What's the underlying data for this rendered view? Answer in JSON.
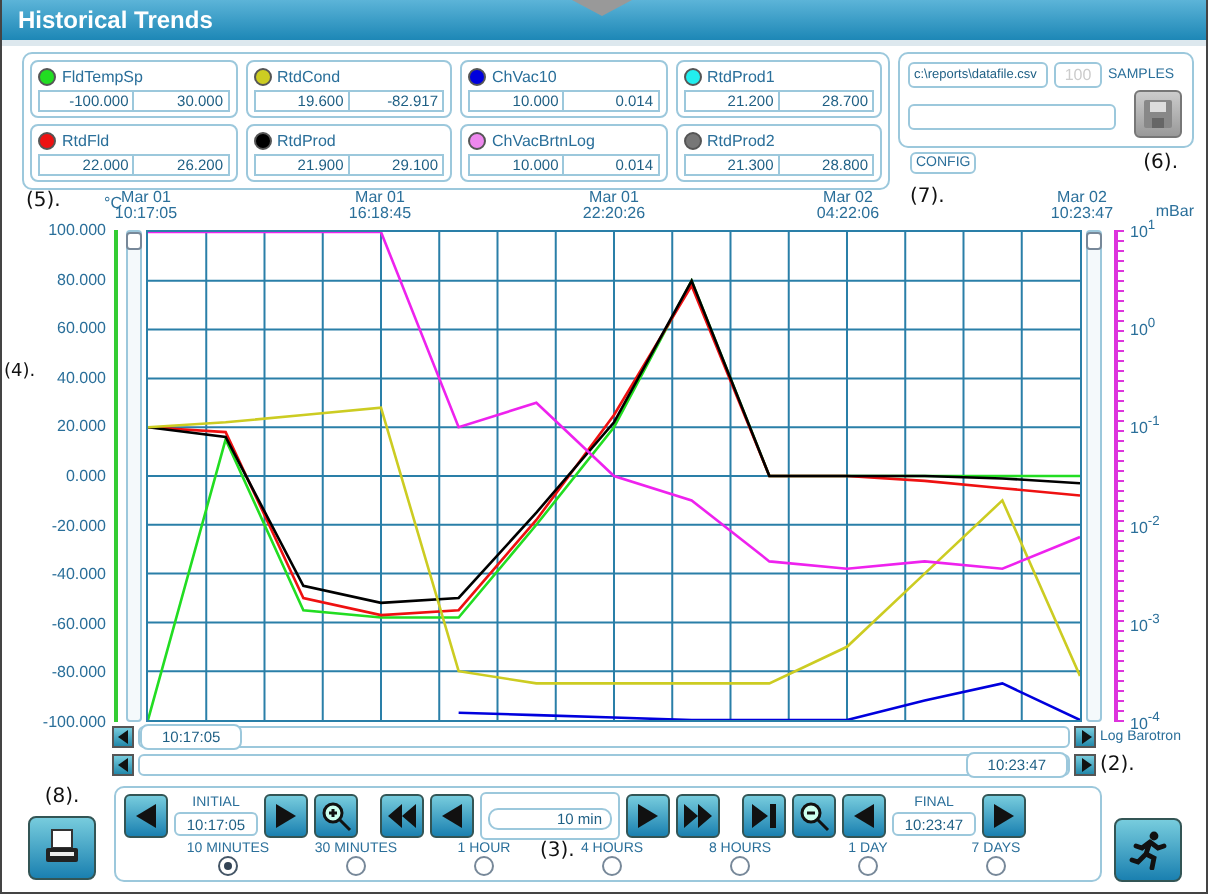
{
  "window": {
    "title": "Historical Trends"
  },
  "tags": [
    {
      "name": "FldTempSp",
      "color": "#22dd22",
      "min": "-100.000",
      "max": "30.000"
    },
    {
      "name": "RtdCond",
      "color": "#cccc22",
      "min": "19.600",
      "max": "-82.917"
    },
    {
      "name": "ChVac10",
      "color": "#0000dd",
      "min": "10.000",
      "max": "0.014"
    },
    {
      "name": "RtdProd1",
      "color": "#22eeee",
      "min": "21.200",
      "max": "28.700"
    },
    {
      "name": "RtdFld",
      "color": "#ee1111",
      "min": "22.000",
      "max": "26.200"
    },
    {
      "name": "RtdProd",
      "color": "#000000",
      "min": "21.900",
      "max": "29.100"
    },
    {
      "name": "ChVacBrtnLog",
      "color": "#ee88ee",
      "min": "10.000",
      "max": "0.014"
    },
    {
      "name": "RtdProd2",
      "color": "#777777",
      "min": "21.300",
      "max": "28.800"
    }
  ],
  "export": {
    "file": "c:\\reports\\datafile.csv",
    "samples": "100",
    "samples_disabled": true,
    "samples_label": "SAMPLES",
    "save_disabled": true
  },
  "config_button": "CONFIG",
  "callouts": {
    "c5": "(5).",
    "c4": "(4).",
    "c7": "(7).",
    "c6": "(6).",
    "c2": "(2).",
    "c3": "(3).",
    "c8": "(8)."
  },
  "chart": {
    "left_slider": {
      "level": 1
    },
    "right_slider": {
      "level": 1
    },
    "left_unit": "°C",
    "right_unit": "mBar",
    "right_ticks": [
      "10$^{1}$",
      "10$^{0}$",
      "10$^{-1}$",
      "10$^{-2}$",
      "10$^{-3}$",
      "10$^{-4}$"
    ],
    "chart_data": {
      "type": "line",
      "categories": [
        "Mar 01\n10:17:05",
        null,
        null,
        "Mar 01\n16:18:45",
        null,
        null,
        "Mar 01\n22:20:26",
        null,
        null,
        "Mar 02\n04:22:06",
        null,
        null,
        "Mar 02\n10:23:47"
      ],
      "series": [
        {
          "color": "#22dd22",
          "values": [
            -100,
            15,
            -55,
            -58,
            -58,
            -20,
            20,
            80,
            0,
            0,
            0,
            0,
            0
          ]
        },
        {
          "color": "#ee1111",
          "values": [
            20,
            18,
            -50,
            -57,
            -55,
            -18,
            25,
            78,
            0,
            0,
            -2,
            -5,
            -8
          ]
        },
        {
          "color": "#000000",
          "values": [
            20,
            16,
            -45,
            -52,
            -50,
            -15,
            22,
            80,
            0,
            0,
            0,
            -1,
            -3
          ]
        },
        {
          "color": "#cccc22",
          "values": [
            20,
            22,
            25,
            28,
            -80,
            -85,
            -85,
            -85,
            -85,
            -70,
            -40,
            -10,
            -82
          ]
        },
        {
          "color": "#0000dd",
          "values": [
            null,
            null,
            null,
            null,
            -97,
            -98,
            -99,
            -100,
            -100,
            -100,
            -92,
            -85,
            -100
          ]
        },
        {
          "color": "#ee22ee",
          "values": [
            100,
            100,
            100,
            100,
            20,
            30,
            0,
            -10,
            -35,
            -38,
            -35,
            -38,
            -25
          ]
        }
      ],
      "ylim": [
        -100,
        100
      ],
      "grid": true,
      "yticks": [
        {
          "value": 100,
          "label": "100.000"
        },
        {
          "value": 80,
          "label": "80.000"
        },
        {
          "value": 60,
          "label": "60.000"
        },
        {
          "value": 40,
          "label": "40.000"
        },
        {
          "value": 20,
          "label": "20.000"
        },
        {
          "value": 0,
          "label": "0.000"
        },
        {
          "value": -20,
          "label": "-20.000"
        },
        {
          "value": -40,
          "label": "-40.000"
        },
        {
          "value": -60,
          "label": "-60.000"
        },
        {
          "value": -80,
          "label": "-80.000"
        },
        {
          "value": -100,
          "label": "-100.000"
        }
      ]
    }
  },
  "scroll": {
    "start": "10:17:05",
    "end": "10:23:47",
    "log_label": "Log Barotron"
  },
  "controls": {
    "initial_label": "INITIAL",
    "initial": "10:17:05",
    "span": "10 min",
    "final_label": "FINAL",
    "final": "10:23:47",
    "ranges": [
      {
        "label": "10 MINUTES",
        "selected": true
      },
      {
        "label": "30 MINUTES",
        "selected": false
      },
      {
        "label": "1 HOUR",
        "selected": false
      },
      {
        "label": "4 HOURS",
        "selected": false
      },
      {
        "label": "8 HOURS",
        "selected": false
      },
      {
        "label": "1 DAY",
        "selected": false
      },
      {
        "label": "7 DAYS",
        "selected": false
      }
    ]
  }
}
